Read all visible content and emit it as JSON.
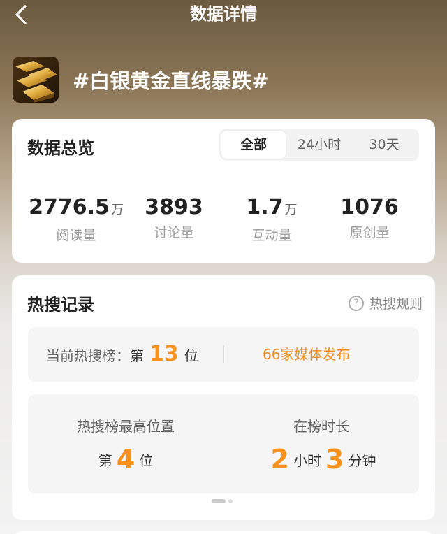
{
  "header": {
    "title": "数据详情",
    "back_icon": "chevron-left-icon"
  },
  "topic": {
    "title": "#白银黄金直线暴跌#",
    "thumb_icon": "gold-bars-image"
  },
  "overview": {
    "title": "数据总览",
    "tabs": [
      "全部",
      "24小时",
      "30天"
    ],
    "active_tab": "全部",
    "stats": [
      {
        "value": "2776.5",
        "unit": "万",
        "label": "阅读量"
      },
      {
        "value": "3893",
        "unit": "",
        "label": "讨论量"
      },
      {
        "value": "1.7",
        "unit": "万",
        "label": "互动量"
      },
      {
        "value": "1076",
        "unit": "",
        "label": "原创量"
      }
    ]
  },
  "hot": {
    "title": "热搜记录",
    "rules_label": "热搜规则",
    "rules_icon": "question-circle-icon",
    "current_label": "当前热搜榜：",
    "current_prefix": "第",
    "current_rank": "13",
    "current_suffix": "位",
    "media_text": "66家媒体发布",
    "peak_label": "热搜榜最高位置",
    "peak_prefix": "第",
    "peak_rank": "4",
    "peak_suffix": "位",
    "duration_label": "在榜时长",
    "duration_hours": "2",
    "duration_hours_unit": "小时",
    "duration_minutes": "3",
    "duration_minutes_unit": "分钟"
  },
  "colors": {
    "accent": "#f7921e",
    "media": "#f08a1d"
  }
}
